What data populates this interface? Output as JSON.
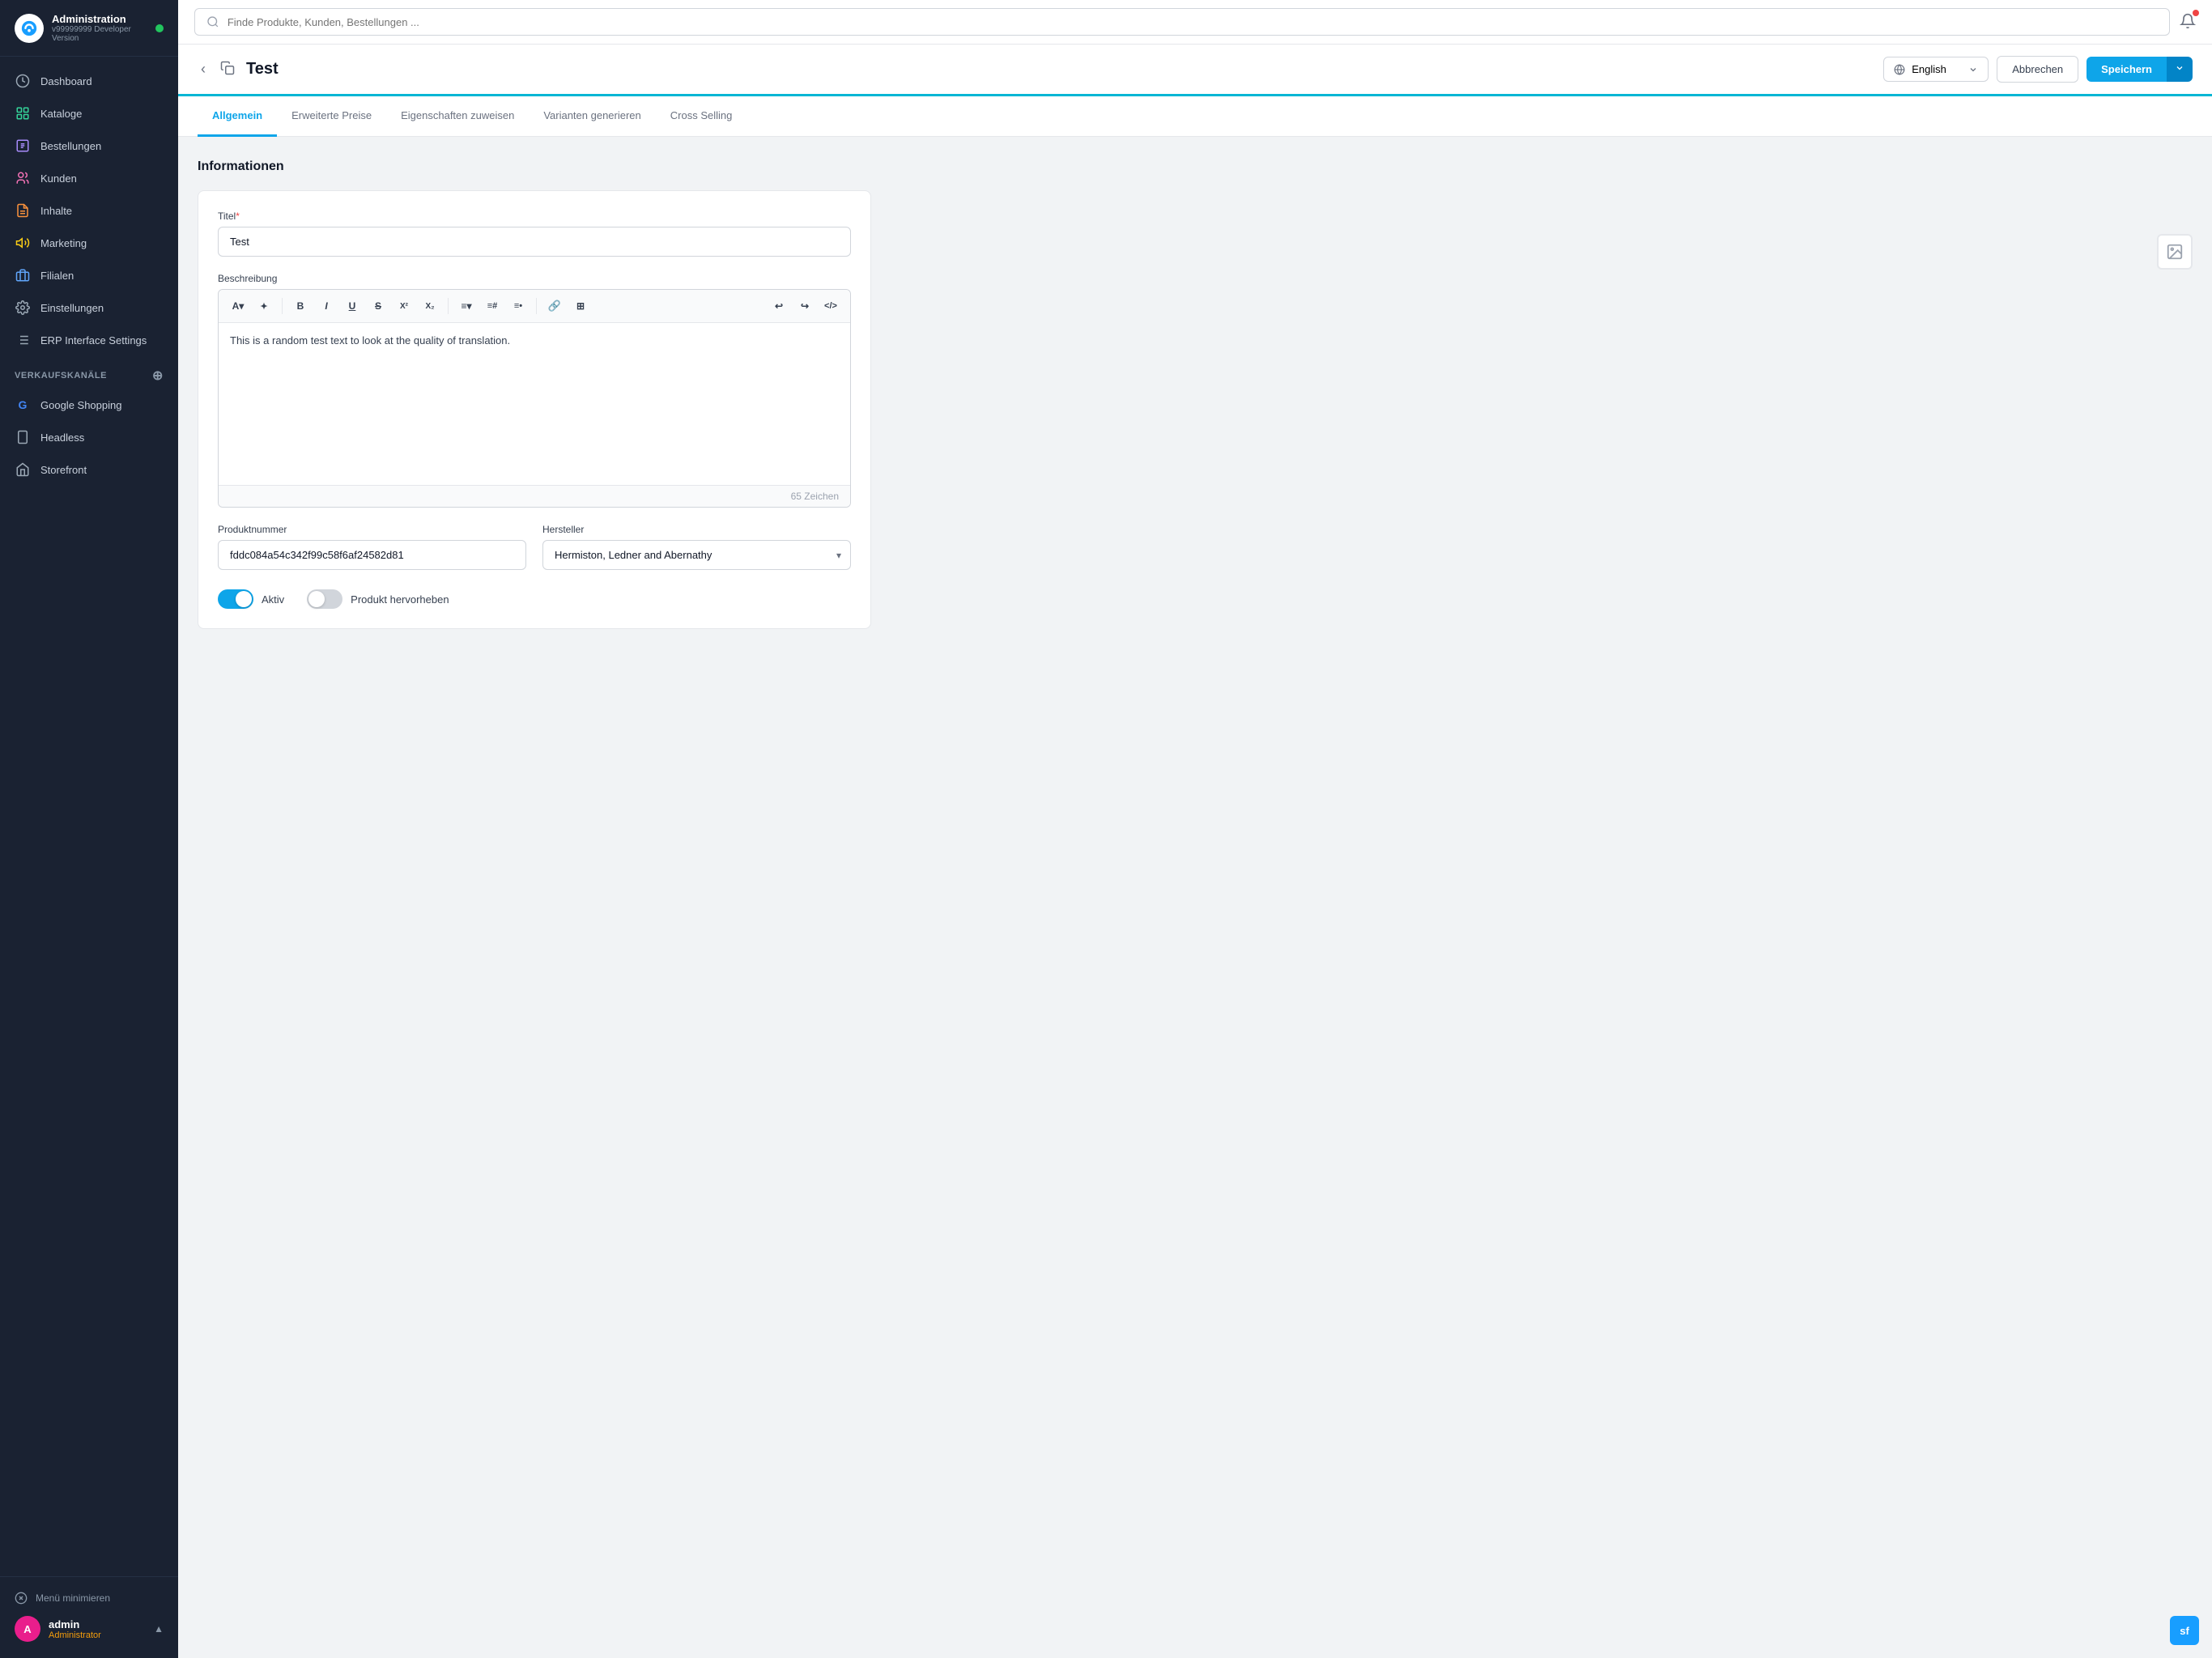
{
  "brand": {
    "name": "Administration",
    "version": "v99999999 Developer Version",
    "status_dot": "online"
  },
  "nav": {
    "items": [
      {
        "id": "dashboard",
        "label": "Dashboard",
        "icon": "dashboard"
      },
      {
        "id": "kataloge",
        "label": "Kataloge",
        "icon": "kataloge"
      },
      {
        "id": "bestellungen",
        "label": "Bestellungen",
        "icon": "bestellungen"
      },
      {
        "id": "kunden",
        "label": "Kunden",
        "icon": "kunden"
      },
      {
        "id": "inhalte",
        "label": "Inhalte",
        "icon": "inhalte"
      },
      {
        "id": "marketing",
        "label": "Marketing",
        "icon": "marketing"
      },
      {
        "id": "filialen",
        "label": "Filialen",
        "icon": "filialen"
      },
      {
        "id": "einstellungen",
        "label": "Einstellungen",
        "icon": "einstellungen"
      },
      {
        "id": "erp",
        "label": "ERP Interface Settings",
        "icon": "erp"
      }
    ],
    "sales_channels_label": "Verkaufskanäle",
    "sales_channels": [
      {
        "id": "google",
        "label": "Google Shopping",
        "icon": "G"
      },
      {
        "id": "headless",
        "label": "Headless",
        "icon": "H"
      },
      {
        "id": "storefront",
        "label": "Storefront",
        "icon": "S"
      }
    ]
  },
  "footer": {
    "minimize_label": "Menü minimieren",
    "user": {
      "initial": "A",
      "name": "admin",
      "role": "Administrator"
    }
  },
  "topbar": {
    "search_placeholder": "Finde Produkte, Kunden, Bestellungen ..."
  },
  "page_header": {
    "title": "Test",
    "language": "English",
    "cancel_label": "Abbrechen",
    "save_label": "Speichern"
  },
  "tabs": [
    {
      "id": "allgemein",
      "label": "Allgemein",
      "active": true
    },
    {
      "id": "erweiterte-preise",
      "label": "Erweiterte Preise",
      "active": false
    },
    {
      "id": "eigenschaften",
      "label": "Eigenschaften zuweisen",
      "active": false
    },
    {
      "id": "varianten",
      "label": "Varianten generieren",
      "active": false
    },
    {
      "id": "cross-selling",
      "label": "Cross Selling",
      "active": false
    }
  ],
  "form": {
    "section_title": "Informationen",
    "titel_label": "Titel",
    "titel_required": "*",
    "titel_value": "Test",
    "beschreibung_label": "Beschreibung",
    "editor_content": "This is a random test text to look at the quality of translation.",
    "char_count": "65 Zeichen",
    "produktnummer_label": "Produktnummer",
    "produktnummer_value": "fddc084a54c342f99c58f6af24582d81",
    "hersteller_label": "Hersteller",
    "hersteller_value": "Hermiston, Ledner and Abernathy",
    "aktiv_label": "Aktiv",
    "hervorheben_label": "Produkt hervorheben"
  },
  "toolbar_buttons": [
    {
      "id": "font",
      "label": "A▾"
    },
    {
      "id": "magic",
      "label": "✦"
    },
    {
      "id": "bold",
      "label": "B"
    },
    {
      "id": "italic",
      "label": "I"
    },
    {
      "id": "underline",
      "label": "U"
    },
    {
      "id": "strikethrough",
      "label": "S̶"
    },
    {
      "id": "superscript",
      "label": "X²"
    },
    {
      "id": "subscript",
      "label": "X₂"
    },
    {
      "id": "align",
      "label": "≡▾"
    },
    {
      "id": "list-ordered",
      "label": "≡#"
    },
    {
      "id": "list-bullet",
      "label": "≡•"
    },
    {
      "id": "link",
      "label": "🔗"
    },
    {
      "id": "table",
      "label": "⊞"
    },
    {
      "id": "undo",
      "label": "↩"
    },
    {
      "id": "redo",
      "label": "↪"
    },
    {
      "id": "code",
      "label": "<>"
    }
  ]
}
